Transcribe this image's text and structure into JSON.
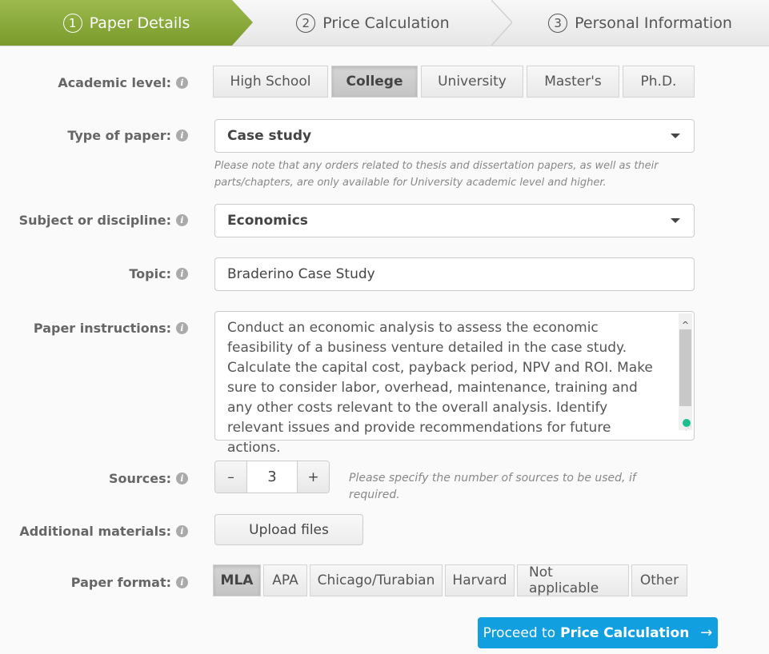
{
  "steps": [
    {
      "num": "1",
      "label": "Paper Details",
      "active": true
    },
    {
      "num": "2",
      "label": "Price Calculation",
      "active": false
    },
    {
      "num": "3",
      "label": "Personal Information",
      "active": false
    }
  ],
  "academic_level": {
    "label": "Academic level:",
    "options": [
      "High School",
      "College",
      "University",
      "Master's",
      "Ph.D."
    ],
    "selected": "College"
  },
  "type_of_paper": {
    "label": "Type of paper:",
    "value": "Case study",
    "note": "Please note that any orders related to thesis and dissertation papers, as well as their parts/chapters, are only available for University academic level and higher."
  },
  "subject": {
    "label": "Subject or discipline:",
    "value": "Economics"
  },
  "topic": {
    "label": "Topic:",
    "value": "Braderino Case Study"
  },
  "instructions": {
    "label": "Paper instructions:",
    "value": "Conduct an economic analysis to assess the economic feasibility of a business venture detailed in the case study. Calculate the capital cost, payback period, NPV and ROI. Make sure to consider labor, overhead, maintenance, training and any other costs relevant to the overall analysis. Identify relevant issues and provide recommendations for future actions."
  },
  "sources": {
    "label": "Sources:",
    "value": "3",
    "minus": "–",
    "plus": "+",
    "hint": "Please specify the number of sources to be used, if required."
  },
  "additional_materials": {
    "label": "Additional materials:",
    "button": "Upload files"
  },
  "paper_format": {
    "label": "Paper format:",
    "options": [
      "MLA",
      "APA",
      "Chicago/Turabian",
      "Harvard",
      "Not applicable",
      "Other"
    ],
    "selected": "MLA"
  },
  "proceed": {
    "prefix": "Proceed to",
    "bold": "Price Calculation",
    "arrow": "→"
  },
  "info_icon": "i",
  "colors": {
    "active_step": "#8aab3a",
    "primary_button": "#129fe0",
    "status_dot": "#1dbf90"
  }
}
